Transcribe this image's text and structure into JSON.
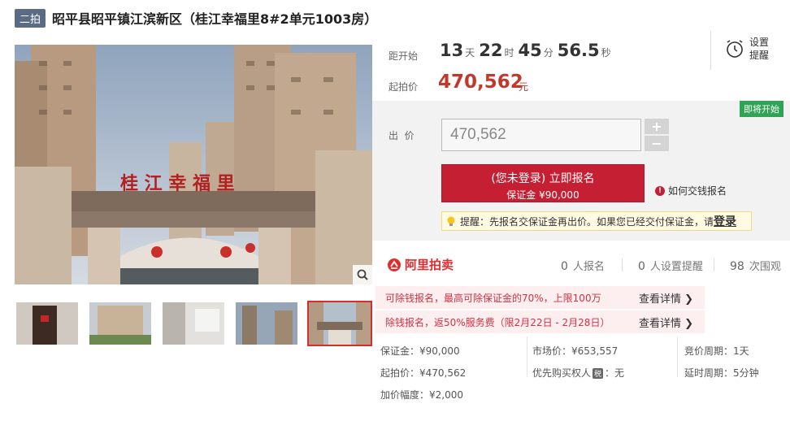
{
  "header": {
    "round_badge": "二拍",
    "title": "昭平县昭平镇江滨新区（桂江幸福里8#2单元1003房）"
  },
  "gallery": {
    "main_image_sign": "桂 江 幸 福 里",
    "thumbnail_count": 5,
    "active_thumbnail": 5
  },
  "countdown": {
    "label": "距开始",
    "days": "13",
    "days_unit": "天",
    "hours": "22",
    "hours_unit": "时",
    "minutes": "45",
    "minutes_unit": "分",
    "seconds": "56.5",
    "seconds_unit": "秒"
  },
  "reminder": {
    "label": "设置提醒"
  },
  "price": {
    "start_label": "起拍价",
    "start_value": "470,562",
    "currency_unit": "元"
  },
  "status_badge": "即将开始",
  "bid": {
    "label": "出  价",
    "input_value": "470,562",
    "plus": "+",
    "minus": "−"
  },
  "signup": {
    "line1": "(您未登录) 立即报名",
    "line2": "保证金 ¥90,000"
  },
  "how_to_pay": {
    "icon_text": "!",
    "label": "如何交钱报名"
  },
  "tip": {
    "text": "提醒：先报名交保证金再出价。如果您已经交付保证金，请",
    "login": "登录"
  },
  "platform": {
    "name": "阿里拍卖"
  },
  "stats": [
    {
      "value": "0",
      "label": "人报名"
    },
    {
      "value": "0",
      "label": "人设置提醒"
    },
    {
      "value": "98",
      "label": "次围观"
    }
  ],
  "promos": [
    {
      "text": "可除钱报名，最高可除保证金的70%，上限100万",
      "link": "查看详情 ❯"
    },
    {
      "text": "除钱报名，返50%服务费（限2月22日 - 2月28日）",
      "link": "查看详情 ❯"
    }
  ],
  "details": {
    "deposit": "保证金：¥90,000",
    "start_price": "起拍价：¥470,562",
    "increment": "加价幅度：¥2,000",
    "market_price": "市场价：¥653,557",
    "priority_label": "优先购买权人",
    "priority_icon": "税",
    "priority_value": "：无",
    "bid_cycle": "竞价周期：1天",
    "delay_cycle": "延时周期：5分钟"
  },
  "colors": {
    "accent_red": "#c51f34",
    "price_red": "#c0392b",
    "status_green": "#2fa455",
    "badge_slate": "#5b6b86",
    "promo_bg": "#fdeef0"
  }
}
